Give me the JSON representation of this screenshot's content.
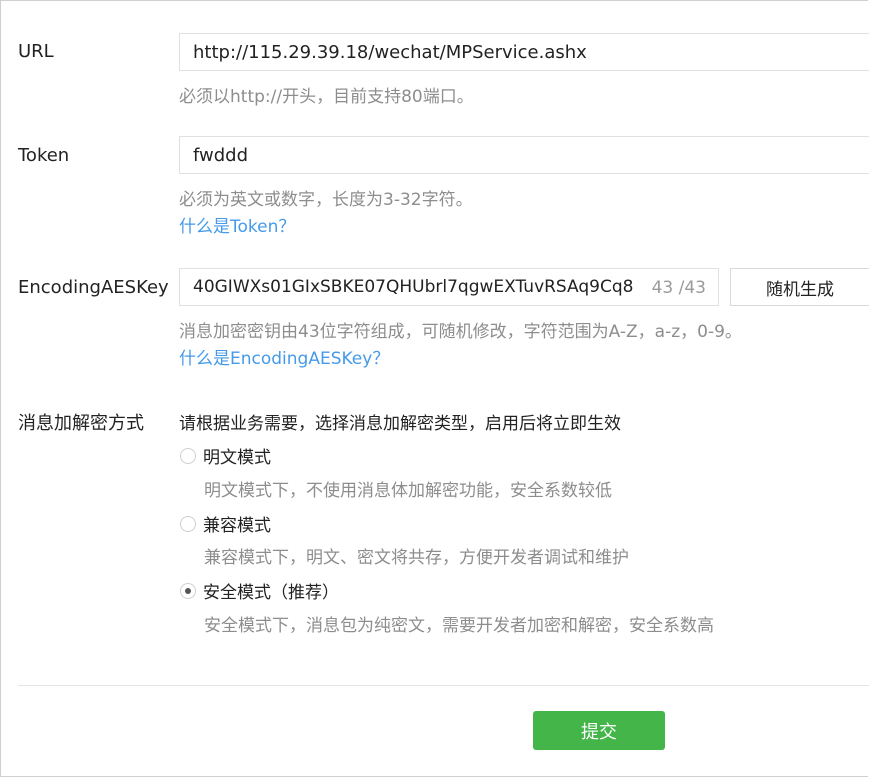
{
  "url": {
    "label": "URL",
    "value": "http://115.29.39.18/wechat/MPService.ashx",
    "hint": "必须以http://开头，目前支持80端口。"
  },
  "token": {
    "label": "Token",
    "value": "fwddd",
    "hint": "必须为英文或数字，长度为3-32字符。",
    "link": "什么是Token？"
  },
  "aes": {
    "label": "EncodingAESKey",
    "value": "40GIWXs01GIxSBKE07QHUbrl7qgwEXTuvRSAq9Cq8",
    "counter": "43 /43",
    "random_button": "随机生成",
    "hint": "消息加密密钥由43位字符组成，可随机修改，字符范围为A-Z，a-z，0-9。",
    "link": "什么是EncodingAESKey？"
  },
  "encryption": {
    "label": "消息加解密方式",
    "intro": "请根据业务需要，选择消息加解密类型，启用后将立即生效",
    "options": [
      {
        "label": "明文模式",
        "desc": "明文模式下，不使用消息体加解密功能，安全系数较低",
        "checked": false
      },
      {
        "label": "兼容模式",
        "desc": "兼容模式下，明文、密文将共存，方便开发者调试和维护",
        "checked": false
      },
      {
        "label": "安全模式（推荐）",
        "desc": "安全模式下，消息包为纯密文，需要开发者加密和解密，安全系数高",
        "checked": true
      }
    ]
  },
  "submit_label": "提交",
  "colors": {
    "accent_green": "#44b549",
    "link_blue": "#459ae9"
  }
}
